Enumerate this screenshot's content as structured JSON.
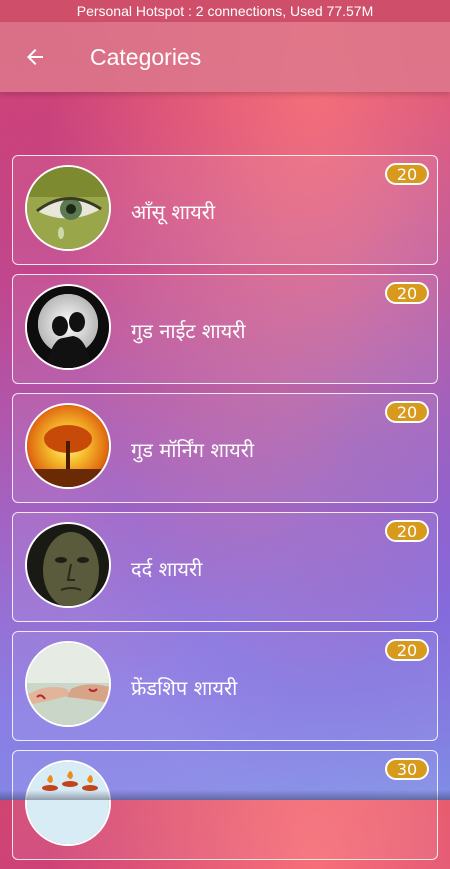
{
  "status_bar": {
    "text": "Personal Hotspot : 2 connections, Used 77.57M"
  },
  "app_bar": {
    "title": "Categories",
    "back_icon": "arrow-left-icon"
  },
  "categories": [
    {
      "label": "आँसू शायरी",
      "count": "20",
      "image": "eye-tear-image"
    },
    {
      "label": "गुड नाईट शायरी",
      "count": "20",
      "image": "couple-moon-silhouette-image"
    },
    {
      "label": "गुड मॉर्निंग शायरी",
      "count": "20",
      "image": "tree-sunrise-image"
    },
    {
      "label": "दर्द शायरी",
      "count": "20",
      "image": "sad-face-image"
    },
    {
      "label": "फ्रेंडशिप शायरी",
      "count": "20",
      "image": "friendship-hands-image"
    },
    {
      "label": "",
      "count": "30",
      "image": "diya-lamps-image"
    }
  ],
  "colors": {
    "badge": "#d89a1c",
    "status_bar": "#cf4f6b"
  }
}
